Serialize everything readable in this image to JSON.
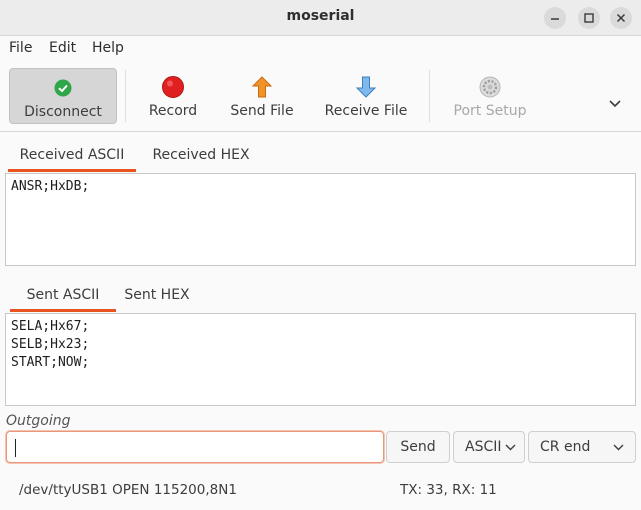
{
  "window": {
    "title": "moserial"
  },
  "menu": [
    "File",
    "Edit",
    "Help"
  ],
  "toolbar": {
    "disconnect": "Disconnect",
    "record": "Record",
    "send_file": "Send File",
    "receive_file": "Receive File",
    "port_setup": "Port Setup"
  },
  "received": {
    "tabs": [
      "Received ASCII",
      "Received HEX"
    ],
    "lines": [
      "ANSR;HxDB;"
    ]
  },
  "sent": {
    "tabs": [
      "Sent ASCII",
      "Sent HEX"
    ],
    "lines": [
      "SELA;Hx67;",
      "SELB;Hx23;",
      "START;NOW;"
    ]
  },
  "outgoing": {
    "label": "Outgoing",
    "value": "",
    "send": "Send",
    "encoding": "ASCII",
    "line_end": "CR end"
  },
  "status": {
    "port": "/dev/ttyUSB1 OPEN 115200,8N1",
    "counts": "TX: 33, RX: 11"
  },
  "colors": {
    "accent": "#e95420",
    "connected": "#2fa64a",
    "record": "#e02020"
  }
}
